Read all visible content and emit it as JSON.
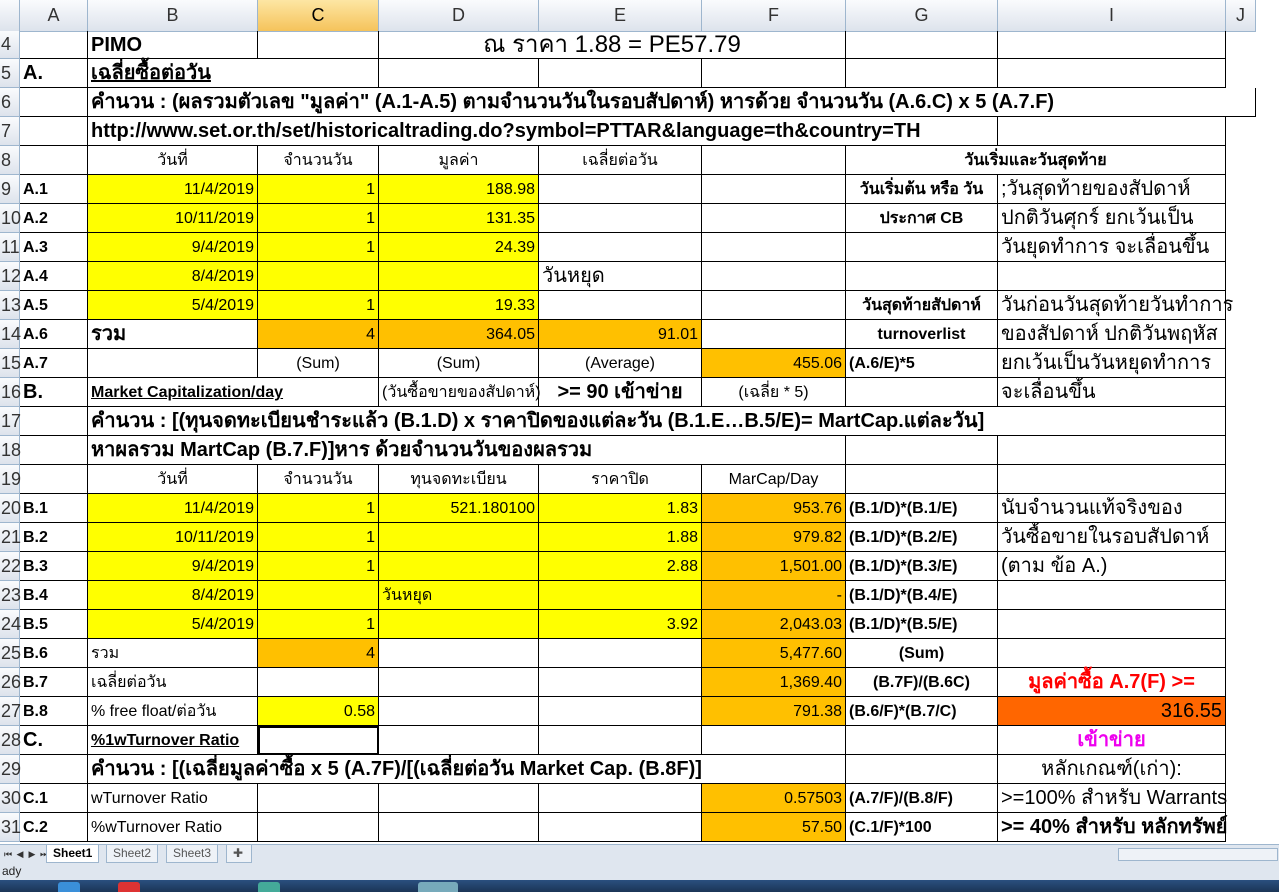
{
  "columns": [
    {
      "key": "A",
      "label": "A"
    },
    {
      "key": "B",
      "label": "B"
    },
    {
      "key": "C",
      "label": "C",
      "selected": true
    },
    {
      "key": "D",
      "label": "D"
    },
    {
      "key": "E",
      "label": "E"
    },
    {
      "key": "F",
      "label": "F"
    },
    {
      "key": "G",
      "label": "G"
    },
    {
      "key": "I",
      "label": "I"
    },
    {
      "key": "J",
      "label": "J"
    }
  ],
  "rows": [
    {
      "label": "4",
      "cells": [
        {
          "col": "B",
          "text": "PIMO",
          "cls": "b big"
        },
        {
          "col": "D",
          "span": 3,
          "text": "ณ ราคา 1.88 = PE57.79",
          "cls": "c huge"
        }
      ]
    },
    {
      "label": "5",
      "cells": [
        {
          "col": "A",
          "text": "A.",
          "cls": "b big"
        },
        {
          "col": "B",
          "span": 2,
          "text": "เฉลี่ยซื้อต่อวัน",
          "cls": "b u big"
        }
      ]
    },
    {
      "label": "6",
      "cells": [
        {
          "col": "B",
          "span": 8,
          "text": "คำนวน : (ผลรวมตัวเลข \"มูลค่า\" (A.1-A.5) ตามจำนวนวันในรอบสัปดาห์) หารด้วย จำนวนวัน (A.6.C) x 5 (A.7.F)",
          "cls": "b big"
        }
      ]
    },
    {
      "label": "7",
      "cells": [
        {
          "col": "B",
          "span": 6,
          "text": "http://www.set.or.th/set/historicaltrading.do?symbol=PTTAR&language=th&country=TH",
          "cls": "b big"
        }
      ]
    },
    {
      "label": "8",
      "cells": [
        {
          "col": "B",
          "text": "วันที่",
          "cls": "c"
        },
        {
          "col": "C",
          "text": "จำนวนวัน",
          "cls": "c"
        },
        {
          "col": "D",
          "text": "มูลค่า",
          "cls": "c"
        },
        {
          "col": "E",
          "text": "เฉลี่ยต่อวัน",
          "cls": "c"
        },
        {
          "col": "G",
          "span": 2,
          "text": "วันเริ่มและวันสุดท้าย",
          "cls": "c b"
        }
      ]
    },
    {
      "label": "9",
      "cells": [
        {
          "col": "A",
          "text": "A.1",
          "cls": "b"
        },
        {
          "col": "B",
          "text": "11/4/2019",
          "cls": "r yel"
        },
        {
          "col": "C",
          "text": "1",
          "cls": "r yel"
        },
        {
          "col": "D",
          "text": "188.98",
          "cls": "r yel"
        },
        {
          "col": "G",
          "text": "วันเริ่มต้น หรือ วัน",
          "cls": "c b"
        },
        {
          "col": "I",
          "text": ";วันสุดท้ายของสัปดาห์",
          "cls": "big"
        }
      ]
    },
    {
      "label": "10",
      "cells": [
        {
          "col": "A",
          "text": "A.2",
          "cls": "b"
        },
        {
          "col": "B",
          "text": "10/11/2019",
          "cls": "r yel"
        },
        {
          "col": "C",
          "text": "1",
          "cls": "r yel"
        },
        {
          "col": "D",
          "text": "131.35",
          "cls": "r yel"
        },
        {
          "col": "G",
          "text": "ประกาศ CB",
          "cls": "c b"
        },
        {
          "col": "I",
          "text": "ปกติวันศุกร์ ยกเว้นเป็น",
          "cls": "big"
        }
      ]
    },
    {
      "label": "11",
      "cells": [
        {
          "col": "A",
          "text": "A.3",
          "cls": "b"
        },
        {
          "col": "B",
          "text": "9/4/2019",
          "cls": "r yel"
        },
        {
          "col": "C",
          "text": "1",
          "cls": "r yel"
        },
        {
          "col": "D",
          "text": "24.39",
          "cls": "r yel"
        },
        {
          "col": "I",
          "text": "วันยุดทำการ จะเลื่อนขึ้น",
          "cls": "big"
        }
      ]
    },
    {
      "label": "12",
      "cells": [
        {
          "col": "A",
          "text": "A.4",
          "cls": "b"
        },
        {
          "col": "B",
          "text": "8/4/2019",
          "cls": "r yel"
        },
        {
          "col": "C",
          "text": "",
          "cls": "yel"
        },
        {
          "col": "D",
          "text": "",
          "cls": "yel"
        },
        {
          "col": "E",
          "text": "วันหยุด",
          "cls": "big"
        }
      ]
    },
    {
      "label": "13",
      "cells": [
        {
          "col": "A",
          "text": "A.5",
          "cls": "b"
        },
        {
          "col": "B",
          "text": "5/4/2019",
          "cls": "r yel"
        },
        {
          "col": "C",
          "text": "1",
          "cls": "r yel"
        },
        {
          "col": "D",
          "text": "19.33",
          "cls": "r yel"
        },
        {
          "col": "G",
          "text": "วันสุดท้ายสัปดาห์",
          "cls": "c b"
        },
        {
          "col": "I",
          "text": "วันก่อนวันสุดท้ายวันทำการ",
          "cls": "big"
        }
      ]
    },
    {
      "label": "14",
      "cells": [
        {
          "col": "A",
          "text": "A.6",
          "cls": "b"
        },
        {
          "col": "B",
          "text": "รวม",
          "cls": "b big"
        },
        {
          "col": "C",
          "text": "4",
          "cls": "r org"
        },
        {
          "col": "D",
          "text": "364.05",
          "cls": "r org"
        },
        {
          "col": "E",
          "text": "91.01",
          "cls": "r org"
        },
        {
          "col": "G",
          "text": "turnoverlist",
          "cls": "c b"
        },
        {
          "col": "I",
          "text": "ของสัปดาห์ ปกติวันพฤหัส",
          "cls": "big"
        }
      ]
    },
    {
      "label": "15",
      "cells": [
        {
          "col": "A",
          "text": "A.7",
          "cls": "b"
        },
        {
          "col": "C",
          "text": "(Sum)",
          "cls": "c"
        },
        {
          "col": "D",
          "text": "(Sum)",
          "cls": "c"
        },
        {
          "col": "E",
          "text": "(Average)",
          "cls": "c"
        },
        {
          "col": "F",
          "text": "455.06",
          "cls": "r org"
        },
        {
          "col": "G",
          "text": "(A.6/E)*5",
          "cls": "b"
        },
        {
          "col": "I",
          "text": "ยกเว้นเป็นวันหยุดทำการ",
          "cls": "big"
        }
      ]
    },
    {
      "label": "16",
      "cells": [
        {
          "col": "A",
          "text": "B.",
          "cls": "b big"
        },
        {
          "col": "B",
          "span": 2,
          "text": "Market Capitalization/day",
          "cls": "b u"
        },
        {
          "col": "D",
          "text": "(วันซื้อขายของสัปดาห์)"
        },
        {
          "col": "E",
          "text": ">= 90 เข้าข่าย",
          "cls": "b big c"
        },
        {
          "col": "F",
          "text": "(เฉลี่ย * 5)",
          "cls": "c"
        },
        {
          "col": "I",
          "text": "จะเลื่อนขึ้น",
          "cls": "big"
        }
      ]
    },
    {
      "label": "17",
      "cells": [
        {
          "col": "B",
          "span": 7,
          "text": "คำนวน :  [(ทุนจดทะเบียนชำระแล้ว (B.1.D) x ราคาปิดของแต่ละวัน (B.1.E…B.5/E)= MartCap.แต่ละวัน]",
          "cls": "b big"
        }
      ]
    },
    {
      "label": "18",
      "cells": [
        {
          "col": "B",
          "span": 5,
          "text": "หาผลรวม MartCap (B.7.F)]หาร ด้วยจำนวนวันของผลรวม",
          "cls": "b big"
        }
      ]
    },
    {
      "label": "19",
      "cells": [
        {
          "col": "B",
          "text": "วันที่",
          "cls": "c"
        },
        {
          "col": "C",
          "text": "จำนวนวัน",
          "cls": "c"
        },
        {
          "col": "D",
          "text": "ทุนจดทะเบียน",
          "cls": "c"
        },
        {
          "col": "E",
          "text": "ราคาปิด",
          "cls": "c"
        },
        {
          "col": "F",
          "text": "MarCap/Day",
          "cls": "c"
        }
      ]
    },
    {
      "label": "20",
      "cells": [
        {
          "col": "A",
          "text": "B.1",
          "cls": "b"
        },
        {
          "col": "B",
          "text": "11/4/2019",
          "cls": "r yel"
        },
        {
          "col": "C",
          "text": "1",
          "cls": "r yel"
        },
        {
          "col": "D",
          "text": "521.180100",
          "cls": "r yel"
        },
        {
          "col": "E",
          "text": "1.83",
          "cls": "r yel"
        },
        {
          "col": "F",
          "text": "953.76",
          "cls": "r org"
        },
        {
          "col": "G",
          "text": "(B.1/D)*(B.1/E)",
          "cls": "b"
        },
        {
          "col": "I",
          "text": "นับจำนวนแท้จริงของ",
          "cls": "big"
        }
      ]
    },
    {
      "label": "21",
      "cells": [
        {
          "col": "A",
          "text": "B.2",
          "cls": "b"
        },
        {
          "col": "B",
          "text": "10/11/2019",
          "cls": "r yel"
        },
        {
          "col": "C",
          "text": "1",
          "cls": "r yel"
        },
        {
          "col": "D",
          "text": "",
          "cls": "yel"
        },
        {
          "col": "E",
          "text": "1.88",
          "cls": "r yel"
        },
        {
          "col": "F",
          "text": "979.82",
          "cls": "r org"
        },
        {
          "col": "G",
          "text": "(B.1/D)*(B.2/E)",
          "cls": "b"
        },
        {
          "col": "I",
          "text": "วันซื้อขายในรอบสัปดาห์",
          "cls": "big"
        }
      ]
    },
    {
      "label": "22",
      "cells": [
        {
          "col": "A",
          "text": "B.3",
          "cls": "b"
        },
        {
          "col": "B",
          "text": "9/4/2019",
          "cls": "r yel"
        },
        {
          "col": "C",
          "text": "1",
          "cls": "r yel"
        },
        {
          "col": "D",
          "text": "",
          "cls": "yel"
        },
        {
          "col": "E",
          "text": "2.88",
          "cls": "r yel"
        },
        {
          "col": "F",
          "text": "1,501.00",
          "cls": "r org"
        },
        {
          "col": "G",
          "text": "(B.1/D)*(B.3/E)",
          "cls": "b"
        },
        {
          "col": "I",
          "text": "(ตาม ข้อ A.)",
          "cls": "big"
        }
      ]
    },
    {
      "label": "23",
      "cells": [
        {
          "col": "A",
          "text": "B.4",
          "cls": "b"
        },
        {
          "col": "B",
          "text": "8/4/2019",
          "cls": "r yel"
        },
        {
          "col": "C",
          "text": "",
          "cls": "yel"
        },
        {
          "col": "D",
          "text": "วันหยุด",
          "cls": "yel"
        },
        {
          "col": "E",
          "text": "",
          "cls": "yel"
        },
        {
          "col": "F",
          "text": "-",
          "cls": "r org"
        },
        {
          "col": "G",
          "text": "(B.1/D)*(B.4/E)",
          "cls": "b"
        }
      ]
    },
    {
      "label": "24",
      "cells": [
        {
          "col": "A",
          "text": "B.5",
          "cls": "b"
        },
        {
          "col": "B",
          "text": "5/4/2019",
          "cls": "r yel"
        },
        {
          "col": "C",
          "text": "1",
          "cls": "r yel"
        },
        {
          "col": "D",
          "text": "",
          "cls": "yel"
        },
        {
          "col": "E",
          "text": "3.92",
          "cls": "r yel"
        },
        {
          "col": "F",
          "text": "2,043.03",
          "cls": "r org"
        },
        {
          "col": "G",
          "text": "(B.1/D)*(B.5/E)",
          "cls": "b"
        }
      ]
    },
    {
      "label": "25",
      "cells": [
        {
          "col": "A",
          "text": "B.6",
          "cls": "b"
        },
        {
          "col": "B",
          "text": "รวม"
        },
        {
          "col": "C",
          "text": "4",
          "cls": "r org"
        },
        {
          "col": "F",
          "text": "5,477.60",
          "cls": "r org"
        },
        {
          "col": "G",
          "text": "(Sum)",
          "cls": "c b"
        }
      ]
    },
    {
      "label": "26",
      "cells": [
        {
          "col": "A",
          "text": "B.7",
          "cls": "b"
        },
        {
          "col": "B",
          "text": "เฉลี่ยต่อวัน"
        },
        {
          "col": "F",
          "text": "1,369.40",
          "cls": "r org"
        },
        {
          "col": "G",
          "text": "(B.7F)/(B.6C)",
          "cls": "c b"
        },
        {
          "col": "I",
          "text": "มูลค่าซื้อ A.7(F) >=",
          "cls": "c b big red"
        }
      ]
    },
    {
      "label": "27",
      "cells": [
        {
          "col": "A",
          "text": "B.8",
          "cls": "b"
        },
        {
          "col": "B",
          "text": "% free float/ต่อวัน"
        },
        {
          "col": "C",
          "text": "0.58",
          "cls": "r yel"
        },
        {
          "col": "F",
          "text": "791.38",
          "cls": "r org"
        },
        {
          "col": "G",
          "text": "(B.6/F)*(B.7/C)",
          "cls": "b"
        },
        {
          "col": "I",
          "text": "316.55",
          "cls": "r dorg big"
        }
      ]
    },
    {
      "label": "28",
      "cells": [
        {
          "col": "A",
          "text": "C.",
          "cls": "b big"
        },
        {
          "col": "B",
          "text": "%1wTurnover Ratio",
          "cls": "b u"
        },
        {
          "col": "C",
          "text": "",
          "cls": "active"
        },
        {
          "col": "I",
          "text": "เข้าข่าย",
          "cls": "c b big mag"
        }
      ]
    },
    {
      "label": "29",
      "cells": [
        {
          "col": "B",
          "span": 5,
          "text": "คำนวน :  [(เฉลี่ยมูลค่าซื้อ x 5  (A.7F)/[(เฉลี่ยต่อวัน Market Cap. (B.8F)]",
          "cls": "b big"
        },
        {
          "col": "I",
          "text": "หลักเกณฑ์(เก่า):",
          "cls": "c big"
        }
      ]
    },
    {
      "label": "30",
      "cells": [
        {
          "col": "A",
          "text": "C.1",
          "cls": "b"
        },
        {
          "col": "B",
          "text": "wTurnover Ratio"
        },
        {
          "col": "F",
          "text": "0.57503",
          "cls": "r org"
        },
        {
          "col": "G",
          "text": "(A.7/F)/(B.8/F)",
          "cls": "b"
        },
        {
          "col": "I",
          "text": ">=100% สำหรับ Warrants",
          "cls": "big"
        }
      ]
    },
    {
      "label": "31",
      "cells": [
        {
          "col": "A",
          "text": "C.2",
          "cls": "b"
        },
        {
          "col": "B",
          "text": " %wTurnover Ratio"
        },
        {
          "col": "F",
          "text": "57.50",
          "cls": "r org"
        },
        {
          "col": "G",
          "text": "(C.1/F)*100",
          "cls": "b"
        },
        {
          "col": "I",
          "text": ">= 40% สำหรับ หลักทรัพย์",
          "cls": "b big"
        }
      ]
    }
  ],
  "sheets": [
    "Sheet1",
    "Sheet2",
    "Sheet3"
  ],
  "active_sheet": "Sheet1",
  "status_text": "ady"
}
